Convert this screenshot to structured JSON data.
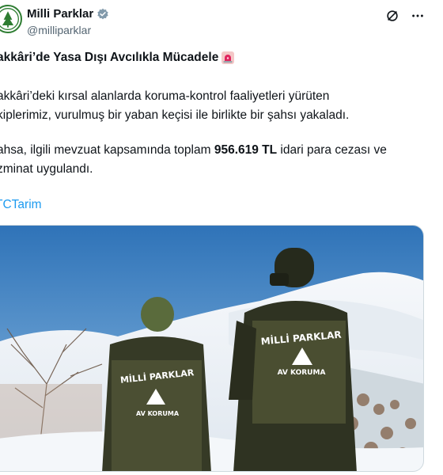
{
  "author": {
    "display_name": "Milli Parklar",
    "handle": "@milliparklar",
    "verified": true,
    "avatar_icon": "milli-parklar-logo-icon"
  },
  "actions": {
    "grok_icon": "grok-icon",
    "more_icon": "more-options-icon"
  },
  "tweet": {
    "title": "akkâri’de Yasa Dışı Avcılıkla Mücadele",
    "title_emoji": "siren-icon",
    "paragraph1_line1": "akkâri’deki kırsal alanlarda koruma-kontrol faaliyetleri yürüten",
    "paragraph1_line2": "kiplerimiz, vurulmuş bir yaban keçisi ile birlikte bir şahsı yakaladı.",
    "paragraph2_line1_pre": "ahsa, ilgili mevzuat kapsamında toplam ",
    "paragraph2_amount": "956.619 TL",
    "paragraph2_line1_post": " idari para cezası ve",
    "paragraph2_line2": "zminat uygulandı.",
    "hashtag": "TCTarim"
  },
  "media": {
    "description_icon": "photo-rangers-in-snow",
    "uniform_text_top": "MİLLİ PARKLAR",
    "uniform_text_bottom": "AV KORUMA",
    "colors": {
      "sky": "#3f86c6",
      "snow": "#f2f5f8",
      "jacket": "#3a3f2a",
      "jacket_panel": "#4a4e31"
    }
  },
  "colors": {
    "link": "#1d9bf0",
    "text": "#0f1419",
    "muted": "#536471",
    "verified": "#829aab"
  }
}
